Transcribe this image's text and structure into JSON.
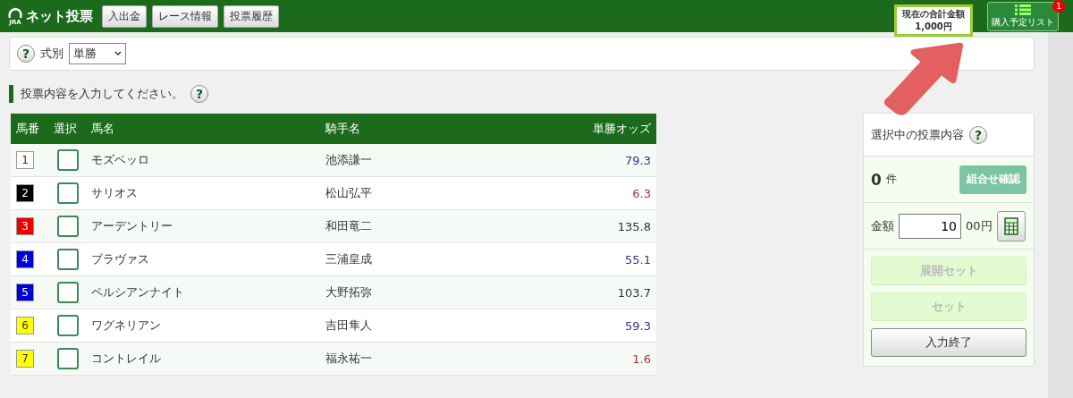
{
  "header": {
    "logo_text": "ネット投票",
    "logo_sub": "JRA",
    "nav": [
      "入出金",
      "レース情報",
      "投票履歴"
    ],
    "total": {
      "label": "現在の合計金額",
      "amount": "1,000円"
    },
    "cart": {
      "label": "購入予定リスト",
      "count": "1"
    }
  },
  "bet_type": {
    "help": "?",
    "label": "式別",
    "value": "単勝"
  },
  "instruction": {
    "text": "投票内容を入力してください。",
    "help": "?"
  },
  "table": {
    "columns": [
      "馬番",
      "選択",
      "馬名",
      "騎手名",
      "単勝オッズ"
    ],
    "rows": [
      {
        "number": {
          "text": "1",
          "color": "#ffffff"
        },
        "checked": false,
        "horse": "モズベッロ",
        "jockey": "池添謙一",
        "odds": {
          "text": "79.3",
          "color": "#333388"
        }
      },
      {
        "number": {
          "text": "2",
          "color": "#000000"
        },
        "checked": false,
        "horse": "サリオス",
        "jockey": "松山弘平",
        "odds": {
          "text": "6.3",
          "color": "#aa3333"
        }
      },
      {
        "number": {
          "text": "3",
          "color": "#ee0000"
        },
        "checked": false,
        "horse": "アーデントリー",
        "jockey": "和田竜二",
        "odds": {
          "text": "135.8",
          "color": "#333333"
        }
      },
      {
        "number": {
          "text": "4",
          "color": "#0000dd"
        },
        "checked": false,
        "horse": "ブラヴァス",
        "jockey": "三浦皇成",
        "odds": {
          "text": "55.1",
          "color": "#333388"
        }
      },
      {
        "number": {
          "text": "5",
          "color": "#0000dd"
        },
        "checked": false,
        "horse": "ペルシアンナイト",
        "jockey": "大野拓弥",
        "odds": {
          "text": "103.7",
          "color": "#333333"
        }
      },
      {
        "number": {
          "text": "6",
          "color": "#ffff00"
        },
        "checked": false,
        "horse": "ワグネリアン",
        "jockey": "吉田隼人",
        "odds": {
          "text": "59.3",
          "color": "#333388"
        }
      },
      {
        "number": {
          "text": "7",
          "color": "#ffff00"
        },
        "checked": false,
        "horse": "コントレイル",
        "jockey": "福永祐一",
        "odds": {
          "text": "1.6",
          "color": "#aa3333"
        }
      }
    ]
  },
  "selection": {
    "title": "選択中の投票内容",
    "help": "?",
    "count": "0",
    "count_unit": "件",
    "confirm": {
      "label": "組合せ確認",
      "disabled": true
    },
    "amount_label": "金額",
    "amount_value": "10",
    "amount_unit": "00円",
    "buttons": [
      {
        "label": "展開セット",
        "disabled": true
      },
      {
        "label": "セット",
        "disabled": true
      },
      {
        "label": "入力終了",
        "disabled": false
      }
    ]
  }
}
